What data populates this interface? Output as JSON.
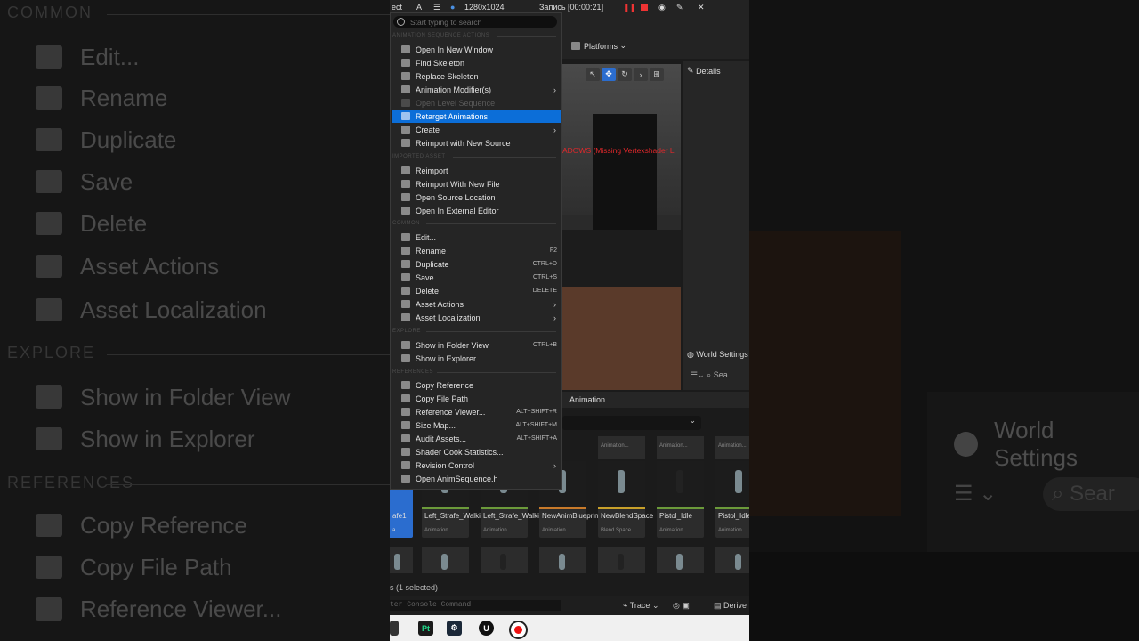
{
  "background": {
    "left_sections": [
      "COMMON",
      "EXPLORE",
      "REFERENCES"
    ],
    "left_items": [
      "Edit...",
      "Rename",
      "Duplicate",
      "Save",
      "Delete",
      "Asset Actions",
      "Asset Localization",
      "Show in Folder View",
      "Show in Explorer",
      "Copy Reference",
      "Copy File Path",
      "Reference Viewer..."
    ],
    "right_world_settings": "World Settings",
    "right_search": "Sear"
  },
  "recorder": {
    "app": "ect",
    "letter": "A",
    "resolution": "1280x1024",
    "recording": "Запись [00:00:21]"
  },
  "editor": {
    "platforms": "Platforms",
    "details": "Details",
    "world_settings": "World Settings",
    "search": "Sea",
    "viewport_warning": "ADOWS (Missing Vertexshader L",
    "anim_tab": "Animation",
    "selection_status": "s (1 selected)",
    "console_placeholder": "ter Console Command",
    "trace": "Trace",
    "derive": "Derive"
  },
  "tiles": [
    {
      "name": "afe1",
      "type": "a..."
    },
    {
      "name": "Left_Strafe_Walking",
      "type": "Animation..."
    },
    {
      "name": "Left_Strafe_Walking1",
      "type": "Animation..."
    },
    {
      "name": "NewAnimBlueprint",
      "type": "Animation..."
    },
    {
      "name": "NewBlendSpace",
      "type": "Blend Space"
    },
    {
      "name": "Pistol_Idle",
      "type": "Animation..."
    },
    {
      "name": "Pistol_Idle",
      "type": "Animation..."
    }
  ],
  "top_tile_types": [
    "Animation...",
    "Animation...",
    "Animation..."
  ],
  "menu": {
    "search_placeholder": "Start typing to search",
    "sections": {
      "anim": "ANIMATION SEQUENCE ACTIONS",
      "imported": "IMPORTED ASSET",
      "common": "COMMON",
      "explore": "EXPLORE",
      "references": "REFERENCES"
    },
    "items": [
      {
        "label": "Open In New Window",
        "shortcut": "",
        "submenu": false
      },
      {
        "label": "Find Skeleton",
        "shortcut": "",
        "submenu": false
      },
      {
        "label": "Replace Skeleton",
        "shortcut": "",
        "submenu": false
      },
      {
        "label": "Animation Modifier(s)",
        "shortcut": "",
        "submenu": true
      },
      {
        "label": "Open Level Sequence",
        "shortcut": "",
        "submenu": false
      },
      {
        "label": "Retarget Animations",
        "shortcut": "",
        "submenu": false
      },
      {
        "label": "Create",
        "shortcut": "",
        "submenu": true
      },
      {
        "label": "Reimport with New Source",
        "shortcut": "",
        "submenu": false
      },
      {
        "label": "Reimport",
        "shortcut": "",
        "submenu": false
      },
      {
        "label": "Reimport With New File",
        "shortcut": "",
        "submenu": false
      },
      {
        "label": "Open Source Location",
        "shortcut": "",
        "submenu": false
      },
      {
        "label": "Open In External Editor",
        "shortcut": "",
        "submenu": false
      },
      {
        "label": "Edit...",
        "shortcut": "",
        "submenu": false
      },
      {
        "label": "Rename",
        "shortcut": "F2",
        "submenu": false
      },
      {
        "label": "Duplicate",
        "shortcut": "CTRL+D",
        "submenu": false
      },
      {
        "label": "Save",
        "shortcut": "CTRL+S",
        "submenu": false
      },
      {
        "label": "Delete",
        "shortcut": "DELETE",
        "submenu": false
      },
      {
        "label": "Asset Actions",
        "shortcut": "",
        "submenu": true
      },
      {
        "label": "Asset Localization",
        "shortcut": "",
        "submenu": true
      },
      {
        "label": "Show in Folder View",
        "shortcut": "CTRL+B",
        "submenu": false
      },
      {
        "label": "Show in Explorer",
        "shortcut": "",
        "submenu": false
      },
      {
        "label": "Copy Reference",
        "shortcut": "",
        "submenu": false
      },
      {
        "label": "Copy File Path",
        "shortcut": "",
        "submenu": false
      },
      {
        "label": "Reference Viewer...",
        "shortcut": "ALT+SHIFT+R",
        "submenu": false
      },
      {
        "label": "Size Map...",
        "shortcut": "ALT+SHIFT+M",
        "submenu": false
      },
      {
        "label": "Audit Assets...",
        "shortcut": "ALT+SHIFT+A",
        "submenu": false
      },
      {
        "label": "Shader Cook Statistics...",
        "shortcut": "",
        "submenu": false
      },
      {
        "label": "Revision Control",
        "shortcut": "",
        "submenu": true
      },
      {
        "label": "Open AnimSequence.h",
        "shortcut": "",
        "submenu": false
      }
    ]
  },
  "taskbar": {
    "pt_label": "Pt"
  },
  "colors": {
    "highlight": "#0c6ed8",
    "warning": "#e0282b",
    "selected_tile": "#2b6dcf"
  }
}
